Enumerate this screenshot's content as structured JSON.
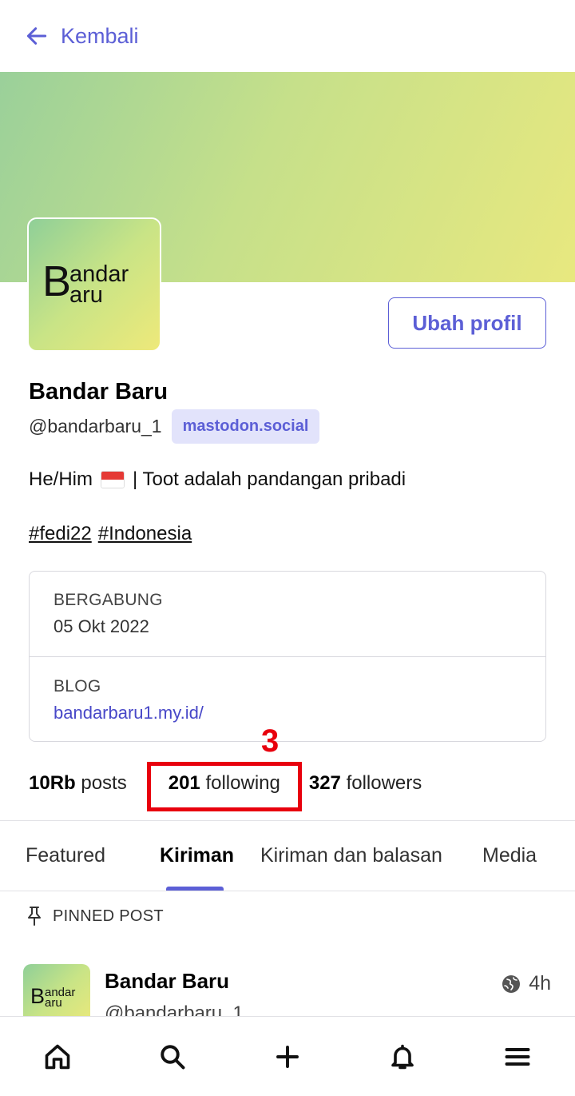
{
  "topbar": {
    "back_label": "Kembali"
  },
  "profile": {
    "logo_big_letter": "B",
    "logo_line1": "andar",
    "logo_line2": "aru",
    "edit_button": "Ubah profil",
    "name": "Bandar Baru",
    "handle": "@bandarbaru_1",
    "server": "mastodon.social",
    "bio_before": "He/Him",
    "bio_flag": "indonesia-flag",
    "bio_after": "| Toot adalah pandangan pribadi",
    "hashtags": [
      "#fedi22",
      "#Indonesia"
    ],
    "fields": [
      {
        "label": "BERGABUNG",
        "value": "05 Okt 2022"
      },
      {
        "label": "BLOG",
        "value": "bandarbaru1.my.id/"
      }
    ],
    "stats": {
      "posts_count": "10Rb",
      "posts_label": "posts",
      "following_count": "201",
      "following_label": "following",
      "followers_count": "327",
      "followers_label": "followers"
    }
  },
  "annotation": {
    "marker": "3",
    "color": "#e8000d"
  },
  "tabs": [
    {
      "label": "Featured"
    },
    {
      "label": "Kiriman",
      "active": true
    },
    {
      "label": "Kiriman dan balasan"
    },
    {
      "label": "Media"
    }
  ],
  "pinned_label": "PINNED POST",
  "post": {
    "name": "Bandar Baru",
    "handle": "@bandarbaru_1",
    "time": "4h",
    "visibility_icon": "globe-icon"
  },
  "bottom_nav": [
    "home-icon",
    "search-icon",
    "compose-icon",
    "notifications-icon",
    "menu-icon"
  ],
  "colors": {
    "accent": "#5c5fd6",
    "link": "#4848c8",
    "badge_bg": "#e2e3fb"
  }
}
